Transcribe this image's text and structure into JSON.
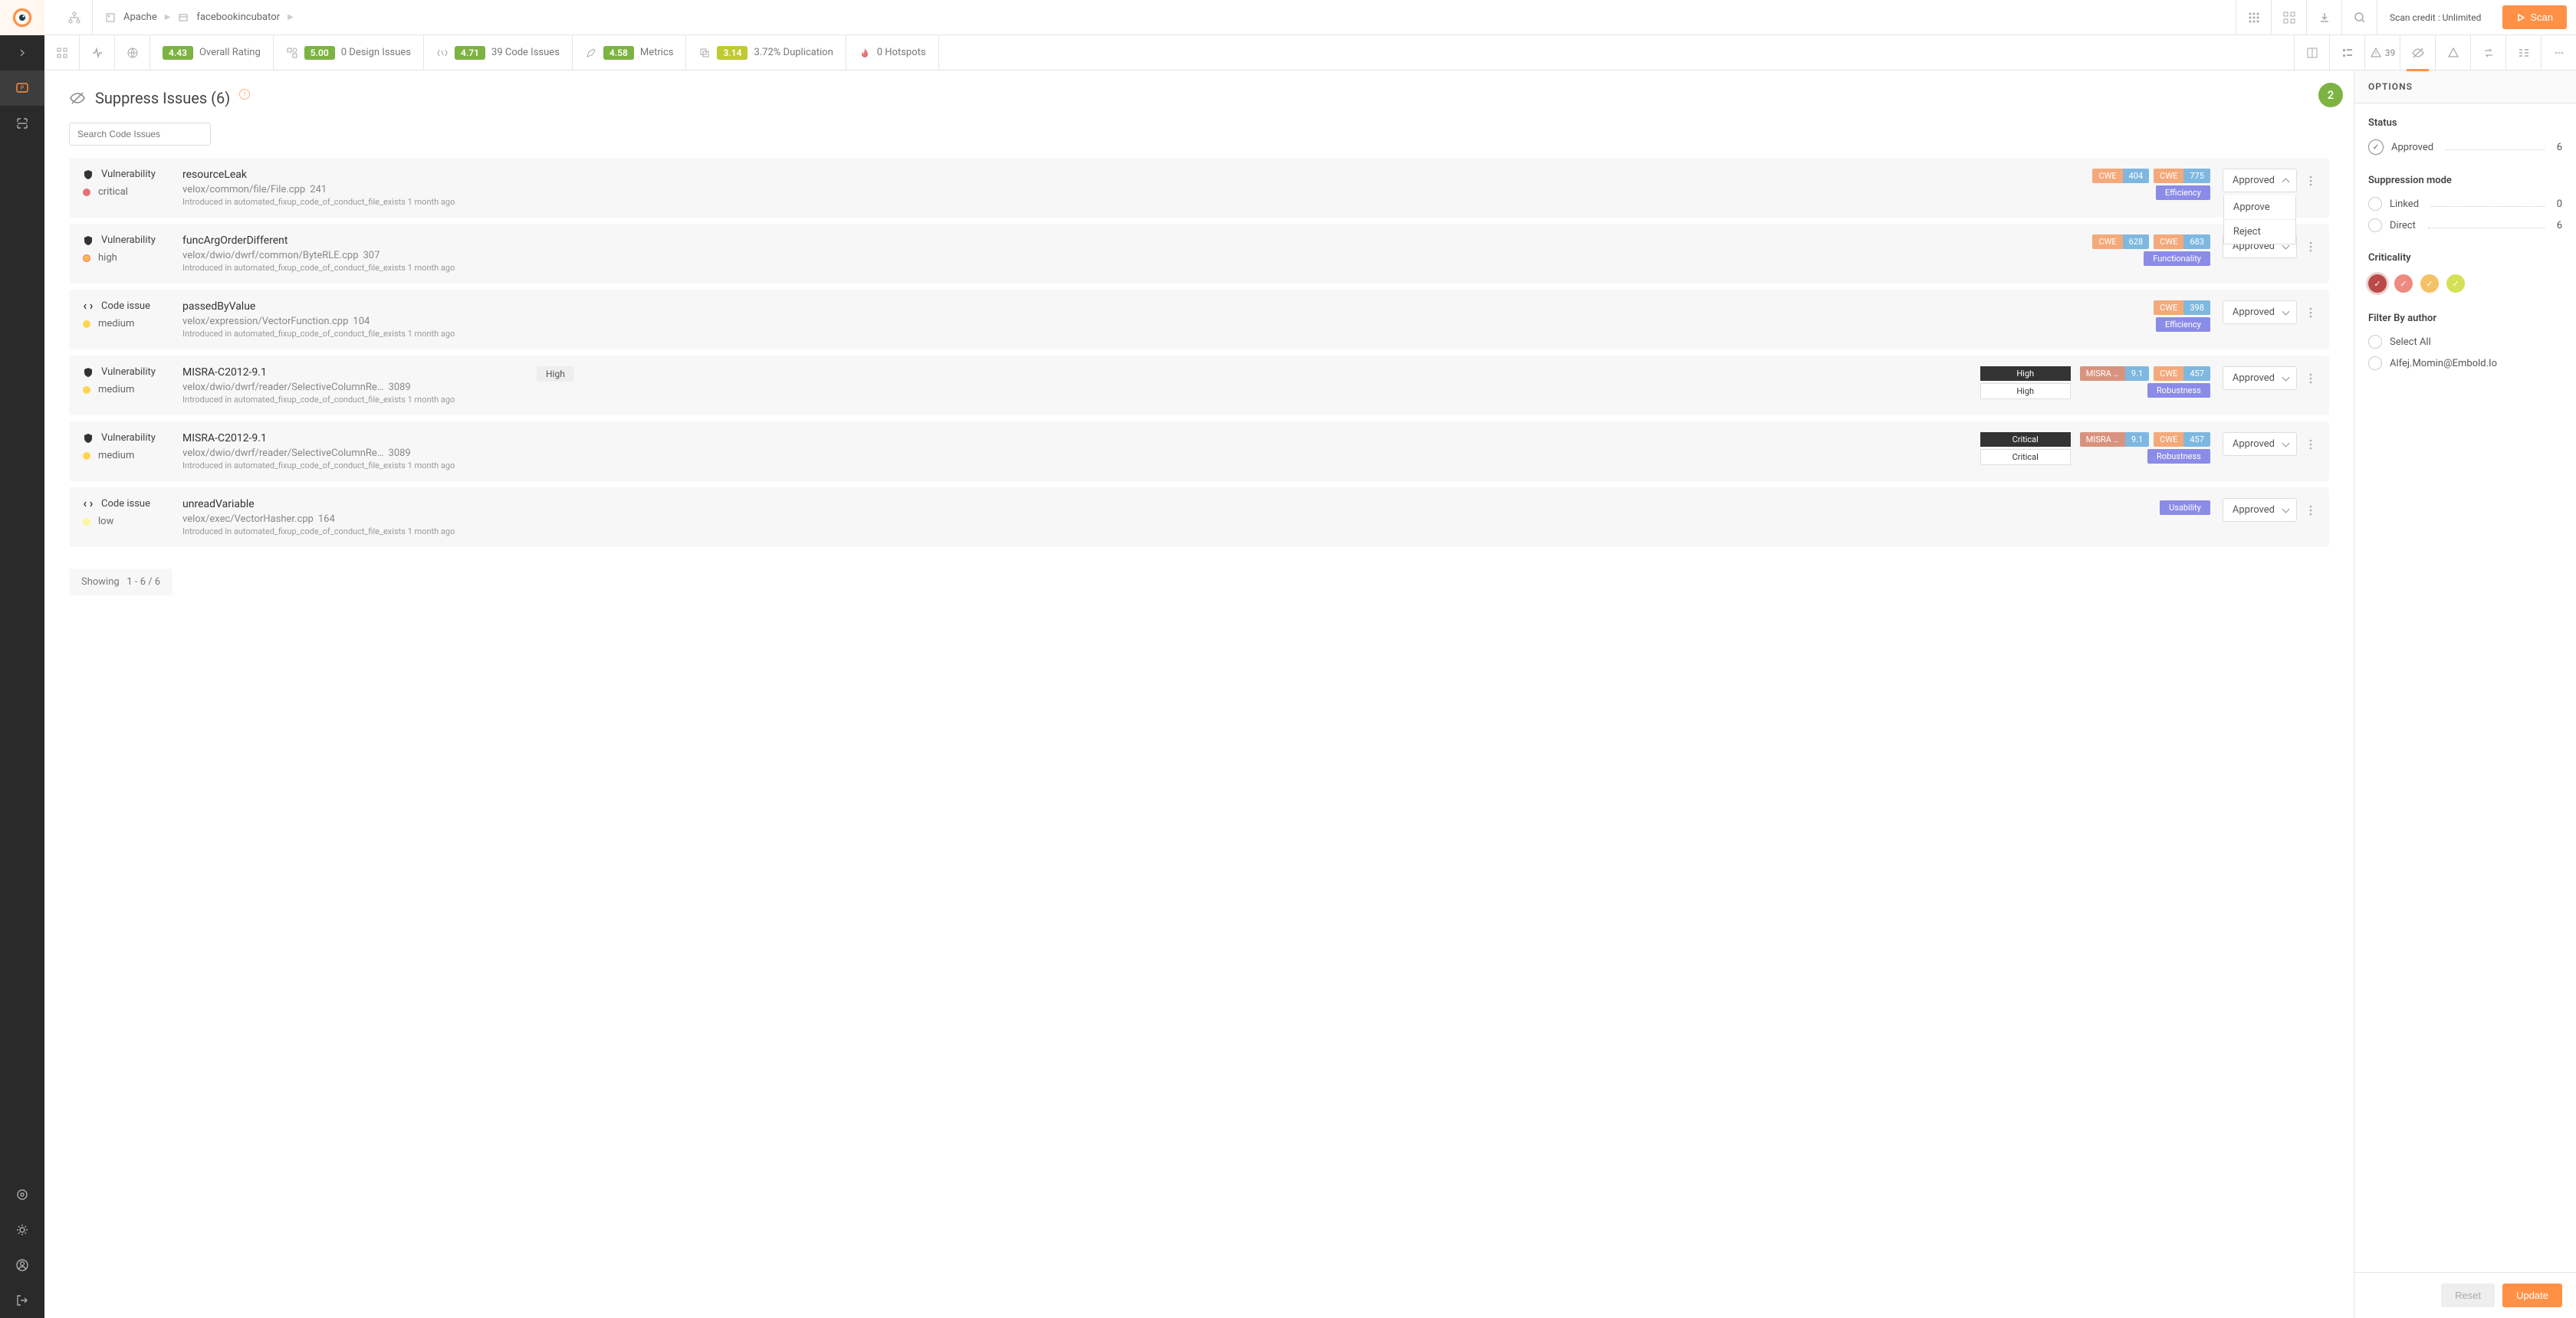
{
  "breadcrumb": {
    "org": "Apache",
    "repo": "facebookincubator"
  },
  "topbar": {
    "scan_credit": "Scan credit : Unlimited",
    "scan_btn": "Scan"
  },
  "metrics": {
    "overall": {
      "score": "4.43",
      "label": "Overall Rating"
    },
    "design": {
      "score": "5.00",
      "label": "0 Design Issues"
    },
    "code": {
      "score": "4.71",
      "label": "39 Code Issues"
    },
    "metrics": {
      "score": "4.58",
      "label": "Metrics"
    },
    "dup": {
      "score": "3.14",
      "label": "3.72% Duplication"
    },
    "hotspots": {
      "label": "0 Hotspots"
    },
    "warn_count": "39"
  },
  "page": {
    "title": "Suppress Issues (6)",
    "search_placeholder": "Search Code Issues",
    "badge": "2",
    "showing": "Showing",
    "range": "1 - 6 / 6"
  },
  "dropdown": {
    "approve": "Approve",
    "reject": "Reject"
  },
  "issues": [
    {
      "type": "Vulnerability",
      "sev": "critical",
      "title": "resourceLeak",
      "path": "velox/common/file/File.cpp",
      "line": "241",
      "intro": "Introduced in automated_fixup_code_of_conduct_file_exists 1 month ago",
      "chips": [
        {
          "k": "CWE",
          "v": "404"
        },
        {
          "k": "CWE",
          "v": "775"
        }
      ],
      "tag": "Efficiency",
      "tagcls": "eff",
      "status": "Approved",
      "open": true
    },
    {
      "type": "Vulnerability",
      "sev": "high",
      "title": "funcArgOrderDifferent",
      "path": "velox/dwio/dwrf/common/ByteRLE.cpp",
      "line": "307",
      "intro": "Introduced in automated_fixup_code_of_conduct_file_exists 1 month ago",
      "chips": [
        {
          "k": "CWE",
          "v": "628"
        },
        {
          "k": "CWE",
          "v": "683"
        }
      ],
      "tag": "Functionality",
      "tagcls": "func",
      "status": "Approved"
    },
    {
      "type": "Code issue",
      "sev": "medium",
      "title": "passedByValue",
      "path": "velox/expression/VectorFunction.cpp",
      "line": "104",
      "intro": "Introduced in automated_fixup_code_of_conduct_file_exists 1 month ago",
      "chips": [
        {
          "k": "CWE",
          "v": "398"
        }
      ],
      "tag": "Efficiency",
      "tagcls": "eff",
      "status": "Approved"
    },
    {
      "type": "Vulnerability",
      "sev": "medium",
      "title": "MISRA-C2012-9.1",
      "path": "velox/dwio/dwrf/reader/SelectiveColumnRe…",
      "line": "3089",
      "intro": "Introduced in automated_fixup_code_of_conduct_file_exists 1 month ago",
      "chips": [
        {
          "k": "MISRA …",
          "v": "9.1",
          "misra": true
        },
        {
          "k": "CWE",
          "v": "457"
        }
      ],
      "tag": "Robustness",
      "tagcls": "rob",
      "status": "Approved",
      "sevbars": [
        "High",
        "High"
      ],
      "hpill": "High"
    },
    {
      "type": "Vulnerability",
      "sev": "medium",
      "title": "MISRA-C2012-9.1",
      "path": "velox/dwio/dwrf/reader/SelectiveColumnRe…",
      "line": "3089",
      "intro": "Introduced in automated_fixup_code_of_conduct_file_exists 1 month ago",
      "chips": [
        {
          "k": "MISRA …",
          "v": "9.1",
          "misra": true
        },
        {
          "k": "CWE",
          "v": "457"
        }
      ],
      "tag": "Robustness",
      "tagcls": "rob",
      "status": "Approved",
      "sevbars": [
        "Critical",
        "Critical"
      ]
    },
    {
      "type": "Code issue",
      "sev": "low",
      "title": "unreadVariable",
      "path": "velox/exec/VectorHasher.cpp",
      "line": "164",
      "intro": "Introduced in automated_fixup_code_of_conduct_file_exists 1 month ago",
      "chips": [],
      "tag": "Usability",
      "tagcls": "usa",
      "status": "Approved"
    }
  ],
  "options": {
    "header": "OPTIONS",
    "status": {
      "title": "Status",
      "approved": "Approved",
      "approved_n": "6"
    },
    "supp": {
      "title": "Suppression mode",
      "linked": "Linked",
      "linked_n": "0",
      "direct": "Direct",
      "direct_n": "6"
    },
    "crit": {
      "title": "Criticality"
    },
    "filter": {
      "title": "Filter By author",
      "all": "Select All",
      "u1": "Alfej.Momin@Embold.Io"
    },
    "reset": "Reset",
    "update": "Update"
  }
}
